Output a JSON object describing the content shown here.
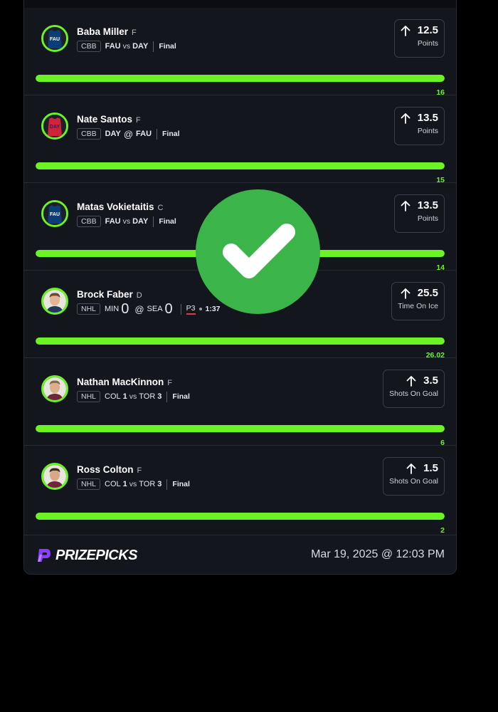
{
  "picks": [
    {
      "player": "Baba Miller",
      "position": "F",
      "league": "CBB",
      "team1": "FAU",
      "connector": "vs",
      "team2": "DAY",
      "status": "Final",
      "line": "12.5",
      "stat": "Points",
      "actual": "16",
      "progress": 1.0,
      "avatar": "jersey-fau-icon",
      "jersey_text": "FAU",
      "jersey_color": "#0b3d78"
    },
    {
      "player": "Nate Santos",
      "position": "F",
      "league": "CBB",
      "team1": "DAY",
      "connector": "@",
      "team2": "FAU",
      "status": "Final",
      "line": "13.5",
      "stat": "Points",
      "actual": "15",
      "progress": 1.0,
      "avatar": "jersey-day-icon",
      "jersey_text": "DAY",
      "jersey_color": "#d0233a"
    },
    {
      "player": "Matas Vokietaitis",
      "position": "C",
      "league": "CBB",
      "team1": "FAU",
      "connector": "vs",
      "team2": "DAY",
      "status": "Final",
      "line": "13.5",
      "stat": "Points",
      "actual": "14",
      "progress": 1.0,
      "avatar": "jersey-fau-icon",
      "jersey_text": "FAU",
      "jersey_color": "#0b3d78"
    },
    {
      "player": "Brock Faber",
      "position": "D",
      "league": "NHL",
      "team1": "MIN",
      "score1": "0",
      "connector": "@",
      "team2": "SEA",
      "score2": "0",
      "period": "P3",
      "clock": "1:37",
      "line": "25.5",
      "stat": "Time On Ice",
      "actual": "26.02",
      "progress": 1.0,
      "avatar": "player-headshot-icon"
    },
    {
      "player": "Nathan MacKinnon",
      "position": "F",
      "league": "NHL",
      "team1": "COL",
      "score1": "1",
      "connector": "vs",
      "team2": "TOR",
      "score2": "3",
      "status": "Final",
      "line": "3.5",
      "stat": "Shots On Goal",
      "actual": "6",
      "progress": 1.0,
      "avatar": "player-headshot-icon"
    },
    {
      "player": "Ross Colton",
      "position": "F",
      "league": "NHL",
      "team1": "COL",
      "score1": "1",
      "connector": "vs",
      "team2": "TOR",
      "score2": "3",
      "status": "Final",
      "line": "1.5",
      "stat": "Shots On Goal",
      "actual": "2",
      "progress": 1.0,
      "avatar": "player-headshot-icon"
    }
  ],
  "footer": {
    "brand": "PRIZEPICKS",
    "timestamp": "Mar 19, 2025 @ 12:03 PM"
  },
  "overlay": {
    "icon": "checkmark-icon",
    "color": "#3bb54a"
  },
  "colors": {
    "accent": "#6cf325",
    "background": "#14161d",
    "brand": "#8b3dff"
  }
}
